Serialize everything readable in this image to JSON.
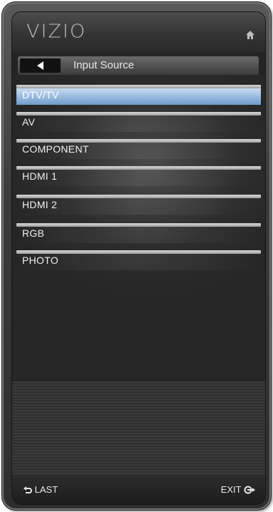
{
  "header": {
    "brand": "VIZIO",
    "home_icon": "home-icon"
  },
  "title_bar": {
    "back_icon": "back-arrow-icon",
    "title": "Input Source"
  },
  "menu": {
    "items": [
      {
        "label": "DTV/TV",
        "selected": true
      },
      {
        "label": "AV",
        "selected": false
      },
      {
        "label": "COMPONENT",
        "selected": false
      },
      {
        "label": "HDMI 1",
        "selected": false
      },
      {
        "label": "HDMI 2",
        "selected": false
      },
      {
        "label": "RGB",
        "selected": false
      },
      {
        "label": "PHOTO",
        "selected": false
      }
    ]
  },
  "footer": {
    "last_label": "LAST",
    "last_icon": "return-icon",
    "exit_label": "EXIT",
    "exit_icon": "exit-icon"
  },
  "colors": {
    "selected_highlight": "#8fb6e0",
    "background": "#242424",
    "text": "#f0f0f0"
  }
}
